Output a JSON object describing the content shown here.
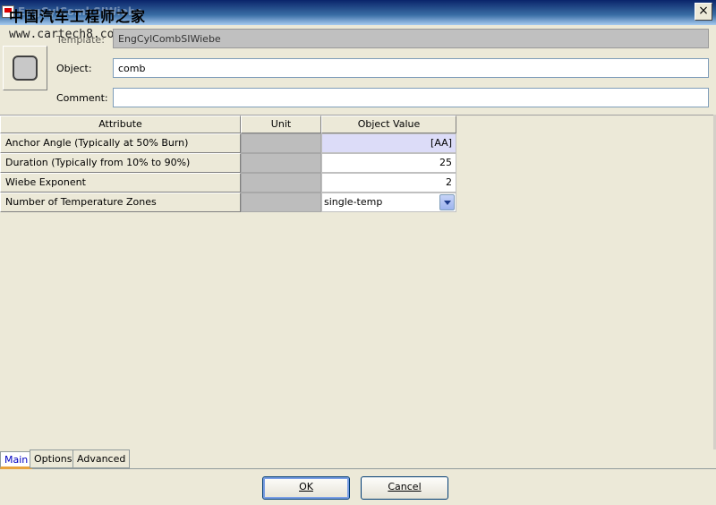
{
  "window": {
    "title": "EngCylCombSIWiebe",
    "close_label": "×"
  },
  "watermark": {
    "cn_text": "中国汽车工程师之家",
    "url": "www.cartech8.com"
  },
  "header": {
    "template_label": "Template:",
    "template_value": "EngCylCombSIWiebe",
    "object_label": "Object:",
    "object_value": "comb",
    "comment_label": "Comment:",
    "comment_value": ""
  },
  "table": {
    "columns": [
      "Attribute",
      "Unit",
      "Object Value"
    ],
    "rows": [
      {
        "attribute": "Anchor Angle (Typically at 50% Burn)",
        "unit": "",
        "value": "[AA]"
      },
      {
        "attribute": "Duration (Typically from 10% to 90%)",
        "unit": "",
        "value": "25"
      },
      {
        "attribute": "Wiebe Exponent",
        "unit": "",
        "value": "2"
      },
      {
        "attribute": "Number of Temperature Zones",
        "unit": "",
        "value": "single-temp"
      }
    ]
  },
  "tabs": [
    {
      "label": "Main",
      "active": true
    },
    {
      "label": "Options",
      "active": false
    },
    {
      "label": "Advanced",
      "active": false
    }
  ],
  "buttons": {
    "ok_label": "OK",
    "cancel_label": "Cancel"
  }
}
